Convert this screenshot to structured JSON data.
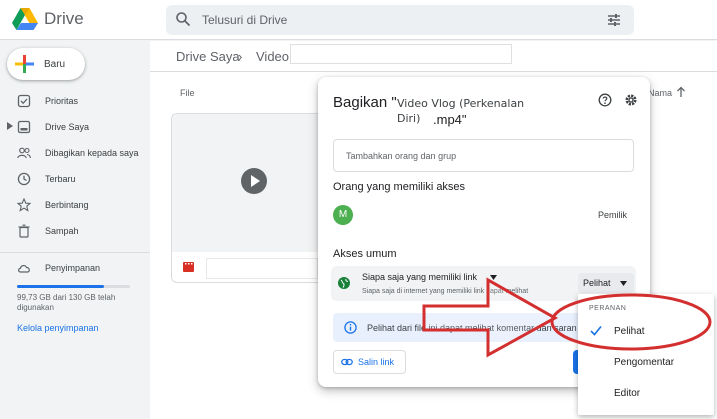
{
  "app": {
    "title": "Drive"
  },
  "search": {
    "placeholder": "Telusuri di Drive"
  },
  "sidebar": {
    "new_label": "Baru",
    "items": [
      {
        "label": "Prioritas",
        "icon": "check-circle-icon"
      },
      {
        "label": "Drive Saya",
        "icon": "my-drive-icon"
      },
      {
        "label": "Dibagikan kepada saya",
        "icon": "people-icon"
      },
      {
        "label": "Terbaru",
        "icon": "clock-icon"
      },
      {
        "label": "Berbintang",
        "icon": "star-icon"
      },
      {
        "label": "Sampah",
        "icon": "trash-icon"
      },
      {
        "label": "Penyimpanan",
        "icon": "cloud-icon"
      }
    ],
    "storage_text": "99,73 GB dari 130 GB telah digunakan",
    "storage_used_fraction": 0.767,
    "storage_link": "Kelola penyimpanan"
  },
  "breadcrumb": {
    "root": "Drive Saya",
    "current": "Video \""
  },
  "list": {
    "col_file": "File",
    "col_name": "Nama"
  },
  "dialog": {
    "title_prefix": "Bagikan \"",
    "title_name": "Video Vlog (Perkenalan Diri)",
    "title_suffix": ".mp4\"",
    "add_people_placeholder": "Tambahkan orang dan grup",
    "access_heading": "Orang yang memiliki akses",
    "owner_initial": "M",
    "owner_role": "Pemilik",
    "general_heading": "Akses umum",
    "general_title": "Siapa saja yang memiliki link",
    "general_desc": "Siapa saja di internet yang memiliki link dapat melihat",
    "role_selected": "Pelihat",
    "info_text": "Pelihat dari file ini dapat melihat komentar dan saran",
    "copy_link": "Salin link"
  },
  "role_menu": {
    "heading": "PERANAN",
    "items": [
      "Pelihat",
      "Pengomentar",
      "Editor"
    ],
    "selected_index": 0
  },
  "colors": {
    "accent": "#1a73e8",
    "annotation_red": "#d32f2f",
    "avatar_green": "#4caf50"
  }
}
